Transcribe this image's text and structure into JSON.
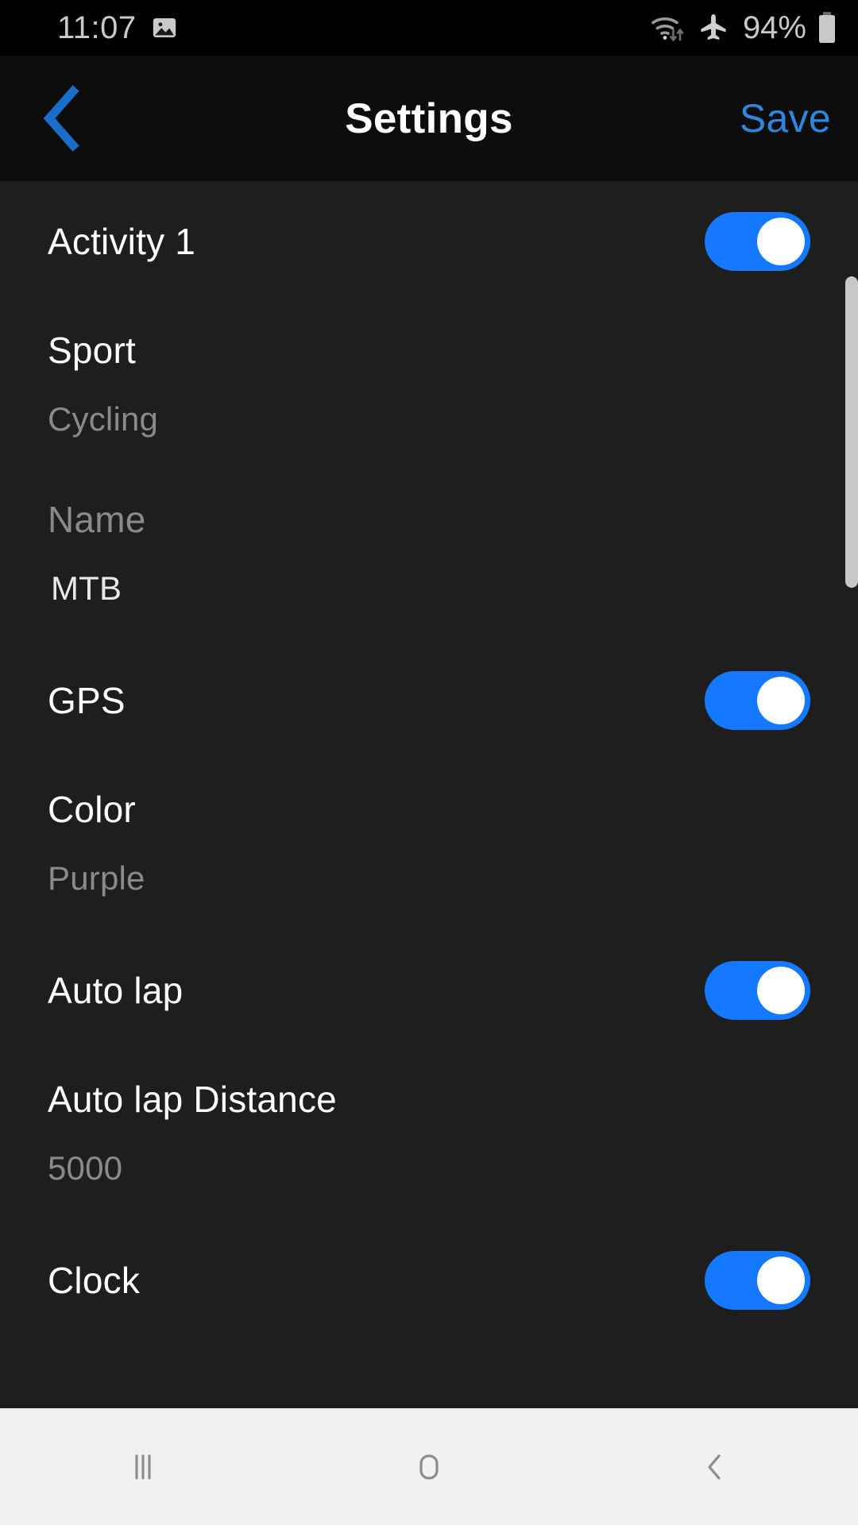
{
  "status_bar": {
    "time": "11:07",
    "gallery_icon": "image-icon",
    "wifi_icon": "wifi-data-icon",
    "airplane_icon": "airplane-mode-icon",
    "battery_percent": "94%",
    "battery_icon": "battery-icon",
    "background": "#000000",
    "text_color": "#c9c9c9"
  },
  "header": {
    "back_icon": "chevron-left-icon",
    "title": "Settings",
    "save_label": "Save",
    "accent": "#2e86de",
    "background": "#0d0d0d"
  },
  "settings": {
    "rows": [
      {
        "type": "switch",
        "label": "Activity 1",
        "state": "on"
      },
      {
        "type": "select",
        "label": "Sport",
        "label_style": "bright",
        "value": "Cycling",
        "value_style": "dim"
      },
      {
        "type": "text",
        "label": "Name",
        "label_style": "dim",
        "value": "MTB",
        "value_style": "bright"
      },
      {
        "type": "switch",
        "label": "GPS",
        "state": "on"
      },
      {
        "type": "select",
        "label": "Color",
        "label_style": "bright",
        "value": "Purple",
        "value_style": "dim"
      },
      {
        "type": "switch",
        "label": "Auto lap",
        "state": "on"
      },
      {
        "type": "text",
        "label": "Auto lap Distance",
        "label_style": "bright",
        "value": "5000",
        "value_style": "dim"
      },
      {
        "type": "switch",
        "label": "Clock",
        "state": "on"
      }
    ],
    "toggle_on_color": "#1479ff",
    "background": "#1e1e1e",
    "scrollbar_color": "#c8c8c8"
  },
  "nav_bar": {
    "recents_icon": "recents-icon",
    "home_icon": "home-icon",
    "back_icon": "nav-back-icon",
    "background": "#f1f1f1",
    "icon_color": "#8c8c8c"
  }
}
